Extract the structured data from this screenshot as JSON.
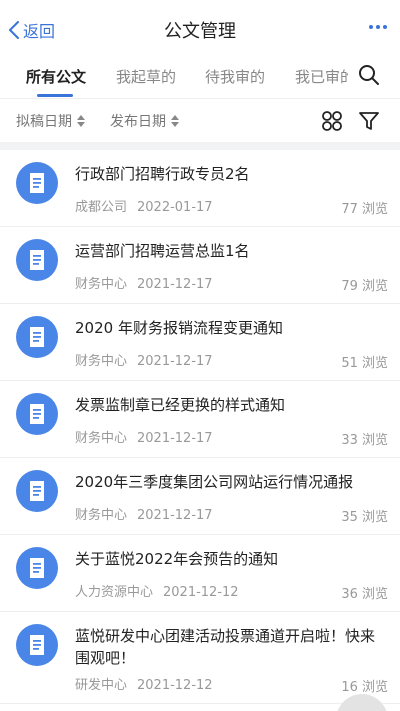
{
  "header": {
    "back_label": "返回",
    "title": "公文管理",
    "more_icon": "more-dots-icon",
    "accent_color": "#3b74d9"
  },
  "tabs": [
    {
      "label": "所有公文",
      "active": true
    },
    {
      "label": "我起草的",
      "active": false
    },
    {
      "label": "待我审的",
      "active": false
    },
    {
      "label": "我已审的",
      "active": false
    }
  ],
  "filters": {
    "draft_date_label": "拟稿日期",
    "publish_date_label": "发布日期"
  },
  "documents": [
    {
      "title": "行政部门招聘行政专员2名",
      "department": "成都公司",
      "date": "2022-01-17",
      "views": "77 浏览"
    },
    {
      "title": "运营部门招聘运营总监1名",
      "department": "财务中心",
      "date": "2021-12-17",
      "views": "79 浏览"
    },
    {
      "title": "2020 年财务报销流程变更通知",
      "department": "财务中心",
      "date": "2021-12-17",
      "views": "51 浏览"
    },
    {
      "title": "发票监制章已经更换的样式通知",
      "department": "财务中心",
      "date": "2021-12-17",
      "views": "33 浏览"
    },
    {
      "title": "2020年三季度集团公司网站运行情况通报",
      "department": "财务中心",
      "date": "2021-12-17",
      "views": "35 浏览"
    },
    {
      "title": "关于蓝悦2022年会预告的通知",
      "department": "人力资源中心",
      "date": "2021-12-12",
      "views": "36 浏览"
    },
    {
      "title": "蓝悦研发中心团建活动投票通道开启啦！快来围观吧！",
      "department": "研发中心",
      "date": "2021-12-12",
      "views": "16 浏览"
    }
  ]
}
